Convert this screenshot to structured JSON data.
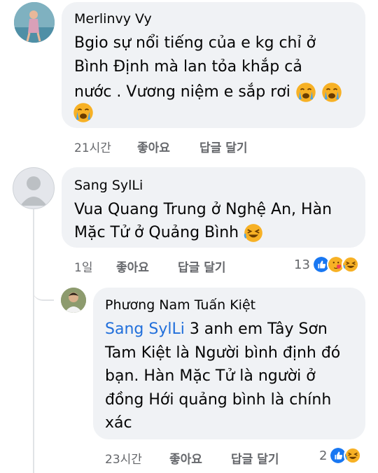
{
  "comments": [
    {
      "author": "Merlinvy Vy",
      "lines": [
        "Bgio sự nổi tiếng của e kg chỉ ở",
        "Bình Định mà lan tỏa khắp cả",
        "nước . Vương niệm e sắp rơi"
      ],
      "time": "21시간",
      "like_label": "좋아요",
      "reply_label": "답글 달기"
    },
    {
      "author": "Sang SylLi",
      "lines": [
        "Vua Quang Trung ở Nghệ An, Hàn",
        "Mặc Tử ở Quảng Bình"
      ],
      "time": "1일",
      "like_label": "좋아요",
      "reply_label": "답글 달기",
      "reaction_count": "13"
    },
    {
      "author": "Phương Nam Tuấn Kiệt",
      "mention": "Sang SylLi",
      "lines": [
        " 3 anh em Tây Sơn",
        "Tam Kiệt là Người bình định đó",
        "bạn. Hàn Mặc Tử là người ở",
        "đồng Hới quảng bình là chính",
        "xác"
      ],
      "time": "23시간",
      "like_label": "좋아요",
      "reply_label": "답글 달기",
      "reaction_count": "2"
    }
  ],
  "colors": {
    "bubble": "#f0f2f5",
    "meta": "#65676b",
    "mention": "#216fdb",
    "like_blue": "#1877f2",
    "haha": "#f7b125"
  }
}
